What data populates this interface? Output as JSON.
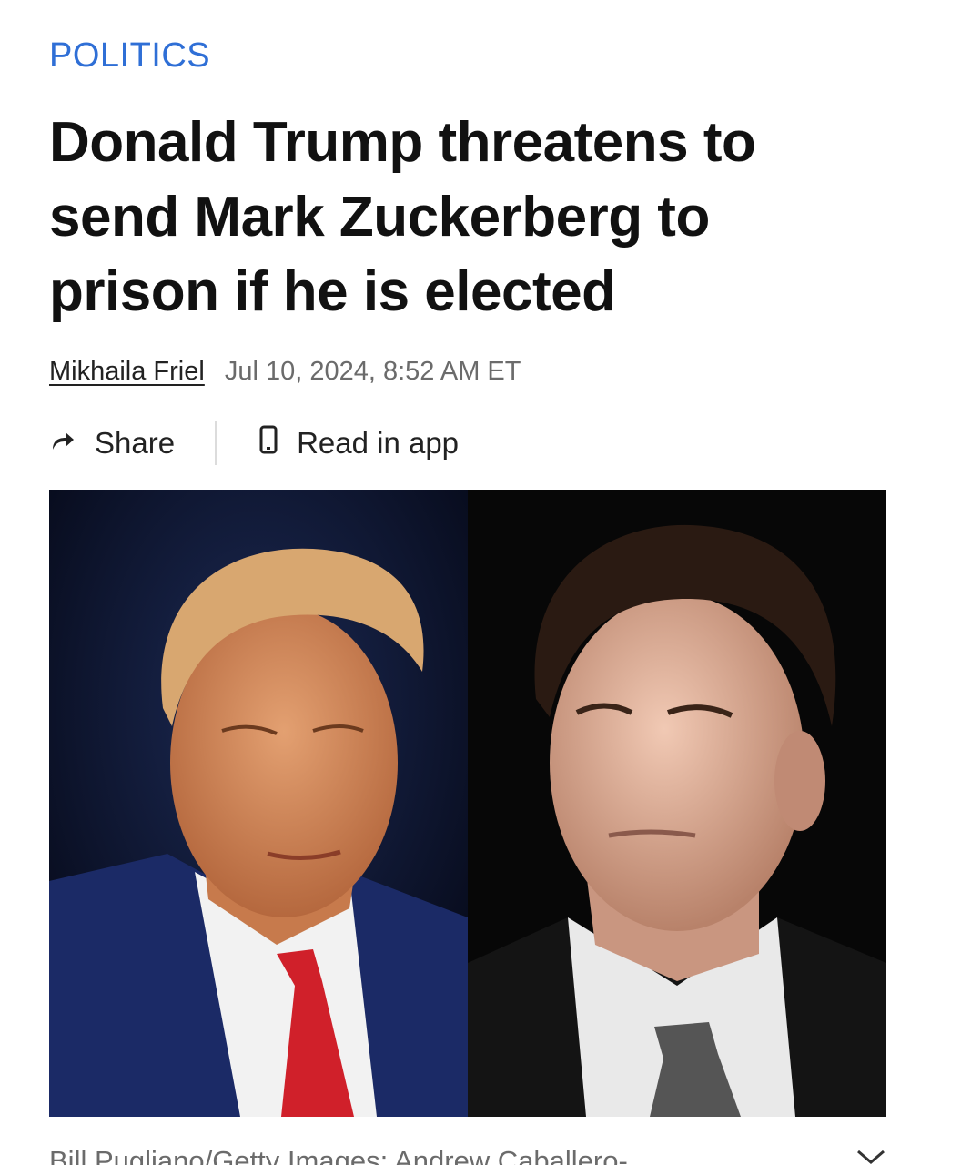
{
  "article": {
    "category": "POLITICS",
    "headline": "Donald Trump threatens to send Mark Zuckerberg to prison if he is elected",
    "author": "Mikhaila Friel",
    "timestamp": "Jul 10, 2024, 8:52 AM ET"
  },
  "actions": {
    "share_label": "Share",
    "share_icon": "share-arrow-icon",
    "read_in_app_label": "Read in app",
    "read_in_app_icon": "phone-icon"
  },
  "photo": {
    "caption": "Bill Pugliano/Getty Images; Andrew Caballero-",
    "expand_icon": "chevron-down-icon"
  },
  "colors": {
    "category": "#2f6fd6",
    "headline": "#111111",
    "meta": "#6b6b6b"
  }
}
